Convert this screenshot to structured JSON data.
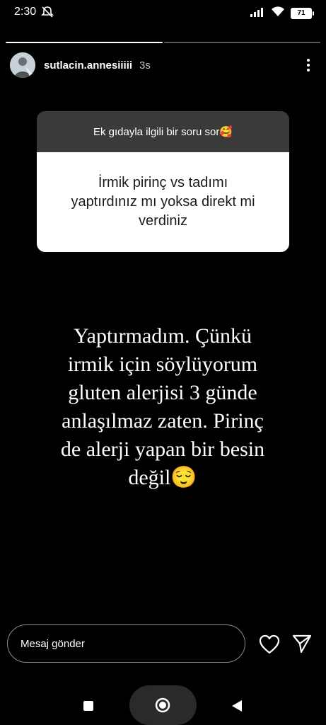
{
  "status_bar": {
    "time": "2:30",
    "battery": "71",
    "icons": [
      "mute-icon",
      "signal-icon",
      "wifi-icon",
      "battery-icon"
    ]
  },
  "story": {
    "segments_total": 2,
    "segments_filled": 1,
    "username": "sutlacin.annesiiiii",
    "time_ago": "3s"
  },
  "question": {
    "prompt": "Ek gıdayla ilgili bir soru sor🥰",
    "text": "İrmik  pirinç vs tadımı\nyaptırdınız mı yoksa direkt mi\nverdiniz"
  },
  "answer": {
    "text": "Yaptırmadım. Çünkü\nirmik için söylüyorum\ngluten alerjisi 3 günde\nanlaşılmaz zaten. Pirinç\nde alerji yapan bir besin\ndeğil😌"
  },
  "reply_bar": {
    "placeholder": "Mesaj gönder",
    "icons": [
      "heart-icon",
      "send-icon"
    ]
  },
  "colors": {
    "background": "#000000",
    "question_header": "#3a3a3a",
    "question_body": "#ffffff"
  }
}
